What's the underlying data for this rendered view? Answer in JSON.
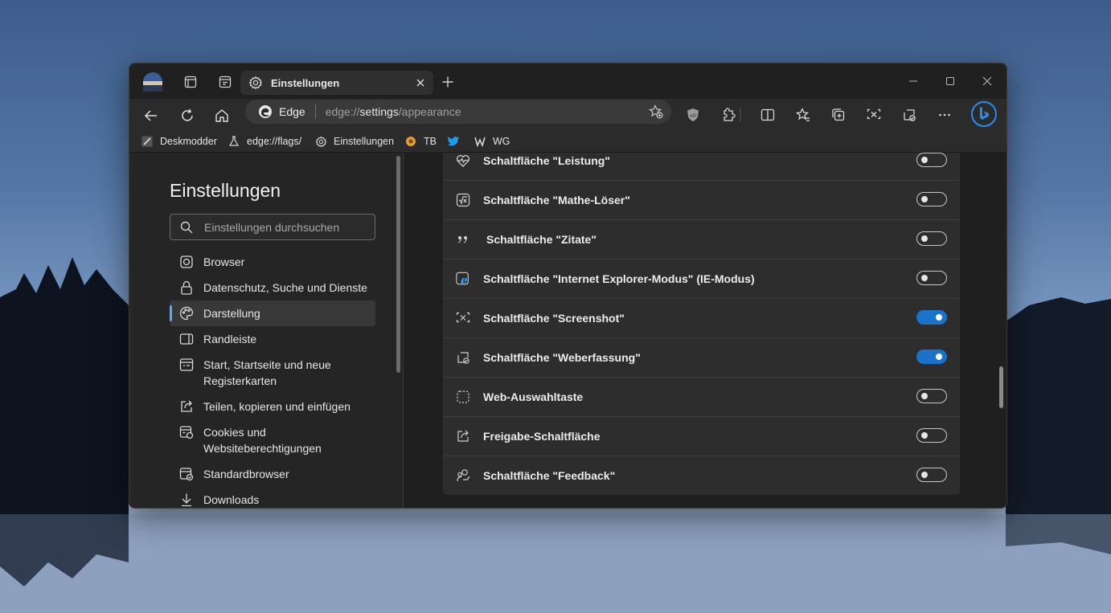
{
  "tab": {
    "title": "Einstellungen"
  },
  "address": {
    "brand": "Edge",
    "url_prefix": "edge://",
    "url_host": "settings",
    "url_path": "/appearance"
  },
  "favorites": [
    {
      "label": "Deskmodder",
      "icon": "pen-icon"
    },
    {
      "label": "edge://flags/",
      "icon": "flask-icon"
    },
    {
      "label": "Einstellungen",
      "icon": "gear-icon"
    },
    {
      "label": "TB",
      "icon": "circle-icon"
    },
    {
      "label": "",
      "icon": "twitter-icon"
    },
    {
      "label": "WG",
      "icon": "wg-icon"
    }
  ],
  "sidebar": {
    "title": "Einstellungen",
    "search_placeholder": "Einstellungen durchsuchen",
    "items": [
      {
        "label": "Browser",
        "icon": "browser-icon",
        "active": false
      },
      {
        "label": "Datenschutz, Suche und Dienste",
        "icon": "lock-icon",
        "active": false
      },
      {
        "label": "Darstellung",
        "icon": "palette-icon",
        "active": true
      },
      {
        "label": "Randleiste",
        "icon": "sidebar-icon",
        "active": false
      },
      {
        "label": "Start, Startseite und neue Registerkarten",
        "icon": "home-tabs-icon",
        "active": false
      },
      {
        "label": "Teilen, kopieren und einfügen",
        "icon": "share-icon",
        "active": false
      },
      {
        "label": "Cookies und Websiteberechtigungen",
        "icon": "cookie-icon",
        "active": false
      },
      {
        "label": "Standardbrowser",
        "icon": "default-browser-icon",
        "active": false
      },
      {
        "label": "Downloads",
        "icon": "download-icon",
        "active": false
      }
    ]
  },
  "settings_rows": [
    {
      "label": "Schaltfläche \"Leistung\"",
      "icon": "heartbeat-icon",
      "enabled": false
    },
    {
      "label": "Schaltfläche \"Mathe-Löser\"",
      "icon": "math-icon",
      "enabled": false
    },
    {
      "label": "Schaltfläche \"Zitate\"",
      "icon": "quote-icon",
      "enabled": false
    },
    {
      "label": "Schaltfläche \"Internet Explorer-Modus\" (IE-Modus)",
      "icon": "ie-icon",
      "enabled": false
    },
    {
      "label": "Schaltfläche \"Screenshot\"",
      "icon": "screenshot-icon",
      "enabled": true
    },
    {
      "label": "Schaltfläche \"Weberfassung\"",
      "icon": "web-capture-icon",
      "enabled": true
    },
    {
      "label": "Web-Auswahltaste",
      "icon": "web-select-icon",
      "enabled": false
    },
    {
      "label": "Freigabe-Schaltfläche",
      "icon": "share-icon",
      "enabled": false
    },
    {
      "label": "Schaltfläche \"Feedback\"",
      "icon": "feedback-icon",
      "enabled": false
    }
  ],
  "colors": {
    "accent": "#1a73c9",
    "active_indicator": "#5aa6ff",
    "twitter": "#1d9bf0",
    "tb_badge": "#e0a030"
  }
}
